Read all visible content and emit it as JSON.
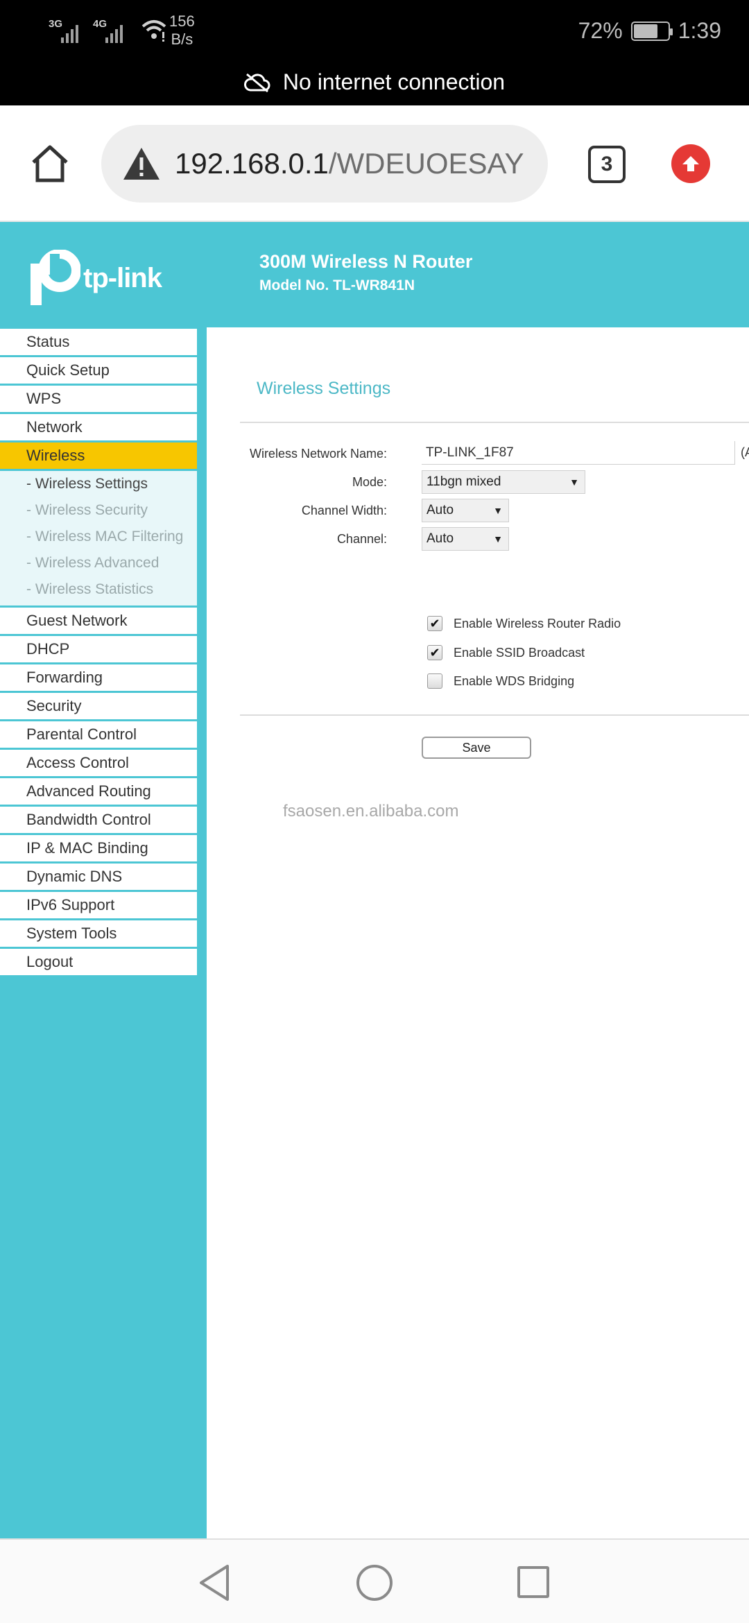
{
  "status_bar": {
    "signal1_label": "3G",
    "signal2_label": "4G",
    "speed_value": "156",
    "speed_unit": "B/s",
    "battery": "72%",
    "battery_level": 0.72,
    "time": "1:39",
    "network_message": "No internet connection"
  },
  "browser": {
    "url_host": "192.168.0.1",
    "url_path": "/WDEUOESAY",
    "tab_count": "3"
  },
  "router": {
    "logo_text": "tp-link",
    "title": "300M Wireless N Router",
    "model": "Model No. TL-WR841N"
  },
  "sidebar": {
    "items_top": [
      "Status",
      "Quick Setup",
      "WPS",
      "Network"
    ],
    "active_item": "Wireless",
    "sub_items": [
      "- Wireless Settings",
      "- Wireless Security",
      "- Wireless MAC Filtering",
      "- Wireless Advanced",
      "- Wireless Statistics"
    ],
    "items_bottom": [
      "Guest Network",
      "DHCP",
      "Forwarding",
      "Security",
      "Parental Control",
      "Access Control",
      "Advanced Routing",
      "Bandwidth Control",
      "IP & MAC Binding",
      "Dynamic DNS",
      "IPv6 Support",
      "System Tools",
      "Logout"
    ]
  },
  "content": {
    "section_title": "Wireless Settings",
    "labels": {
      "ssid": "Wireless Network Name:",
      "mode": "Mode:",
      "channel_width": "Channel Width:",
      "channel": "Channel:"
    },
    "ssid_value": "TP-LINK_1F87",
    "ssid_suffix": "(A",
    "mode_value": "11bgn mixed",
    "channel_width_value": "Auto",
    "channel_value": "Auto",
    "checkboxes": {
      "radio": {
        "label": "Enable Wireless Router Radio",
        "checked": true
      },
      "ssid_broadcast": {
        "label": "Enable SSID Broadcast",
        "checked": true
      },
      "wds": {
        "label": "Enable WDS Bridging",
        "checked": false
      }
    },
    "save_label": "Save",
    "watermark": "fsaosen.en.alibaba.com"
  },
  "colors": {
    "brand_teal": "#4cc6d4",
    "active_yellow": "#f7c600",
    "alert_red": "#e53935"
  },
  "icons": [
    "signal-icon",
    "wifi-icon",
    "battery-icon",
    "cloud-off-icon",
    "home-icon",
    "warning-icon",
    "tabs-icon",
    "update-arrow-icon",
    "back-icon",
    "home-circle-icon",
    "recents-icon"
  ]
}
